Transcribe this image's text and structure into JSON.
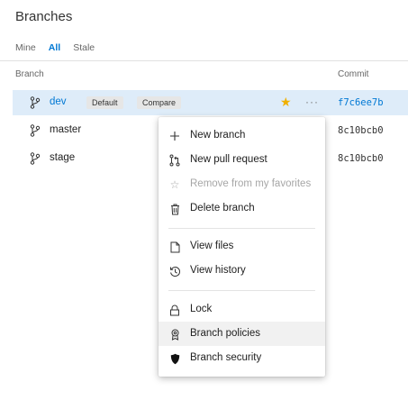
{
  "page": {
    "title": "Branches",
    "filters": [
      {
        "label": "Mine",
        "active": false
      },
      {
        "label": "All",
        "active": true
      },
      {
        "label": "Stale",
        "active": false
      }
    ]
  },
  "table": {
    "columns": {
      "branch": "Branch",
      "commit": "Commit"
    },
    "rows": [
      {
        "name": "dev",
        "badge_default": "Default",
        "badge_compare": "Compare",
        "commit": "f7c6ee7b",
        "selected": true,
        "favorite": true
      },
      {
        "name": "master",
        "commit": "8c10bcb0",
        "selected": false
      },
      {
        "name": "stage",
        "commit": "8c10bcb0",
        "selected": false
      }
    ],
    "more_label": "···"
  },
  "context_menu": {
    "items": [
      {
        "label": "New branch",
        "icon": "plus-icon",
        "disabled": false
      },
      {
        "label": "New pull request",
        "icon": "pull-request-icon",
        "disabled": false
      },
      {
        "label": "Remove from my favorites",
        "icon": "star-outline-icon",
        "disabled": true
      },
      {
        "label": "Delete branch",
        "icon": "trash-icon",
        "disabled": false
      },
      {
        "label": "View files",
        "icon": "file-icon",
        "disabled": false
      },
      {
        "label": "View history",
        "icon": "history-icon",
        "disabled": false
      },
      {
        "label": "Lock",
        "icon": "lock-icon",
        "disabled": false
      },
      {
        "label": "Branch policies",
        "icon": "policy-badge-icon",
        "disabled": false,
        "hovered": true
      },
      {
        "label": "Branch security",
        "icon": "shield-icon",
        "disabled": false
      }
    ]
  },
  "colors": {
    "accent": "#0078d4",
    "selected_row": "#deecf9",
    "star": "#f0b000",
    "disabled_text": "#a6a6a6"
  }
}
